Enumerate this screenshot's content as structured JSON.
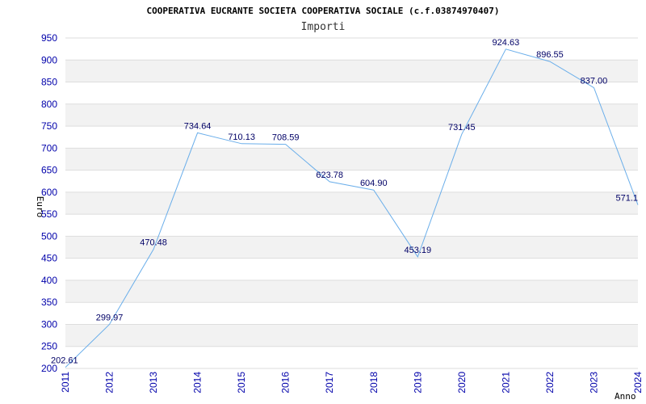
{
  "chart_data": {
    "type": "line",
    "title": "COOPERATIVA EUCRANTE SOCIETA COOPERATIVA SOCIALE (c.f.03874970407)",
    "subtitle": "Importi",
    "xlabel": "Anno",
    "ylabel": "Euro",
    "x": [
      "2011",
      "2012",
      "2013",
      "2014",
      "2015",
      "2016",
      "2017",
      "2018",
      "2019",
      "2020",
      "2021",
      "2022",
      "2023",
      "2024"
    ],
    "series": [
      {
        "values": [
          202.61,
          299.97,
          470.48,
          734.64,
          710.13,
          708.59,
          623.78,
          604.9,
          453.19,
          731.45,
          924.63,
          896.55,
          837.0,
          571.1
        ],
        "labels": [
          "202.61",
          "299.97",
          "470.48",
          "734.64",
          "710.13",
          "708.59",
          "623.78",
          "604.90",
          "453.19",
          "731.45",
          "924.63",
          "896.55",
          "837.00",
          "571.1"
        ]
      }
    ],
    "ylim": [
      200,
      950
    ],
    "yticks": [
      200,
      250,
      300,
      350,
      400,
      450,
      500,
      550,
      600,
      650,
      700,
      750,
      800,
      850,
      900,
      950
    ],
    "grid": true,
    "colors": {
      "line": "#6aaeea",
      "band": "#f2f2f2",
      "grid": "#dddddd",
      "tick": "#0000aa",
      "label": "#000066"
    }
  }
}
